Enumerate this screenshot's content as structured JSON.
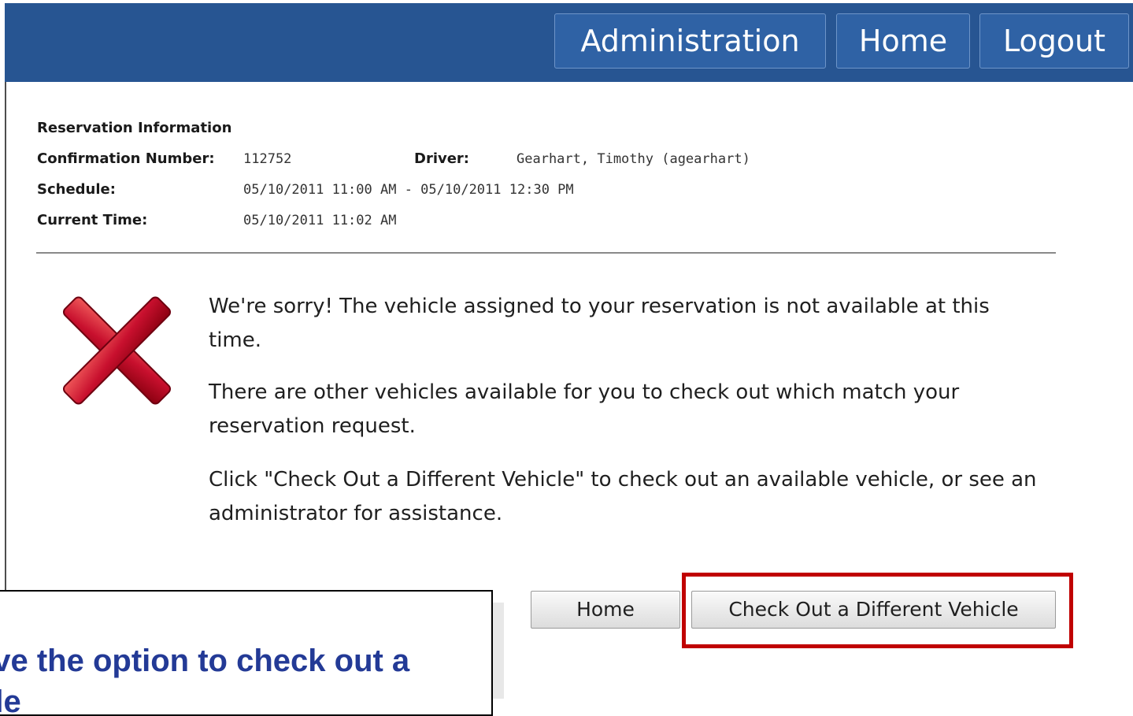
{
  "nav": {
    "administration": "Administration",
    "home": "Home",
    "logout": "Logout"
  },
  "reservation": {
    "heading": "Reservation Information",
    "confirmation_label": "Confirmation Number:",
    "confirmation_value": "112752",
    "driver_label": "Driver:",
    "driver_value": "Gearhart, Timothy (agearhart)",
    "schedule_label": "Schedule:",
    "schedule_value": "05/10/2011 11:00 AM - 05/10/2011 12:30 PM",
    "current_time_label": "Current Time:",
    "current_time_value": "05/10/2011 11:02 AM"
  },
  "message": {
    "line1": "We're sorry! The vehicle assigned to your reservation is not available at this time.",
    "line2": "There are other vehicles available for you to check out which match your reservation request.",
    "line3": "Click \"Check Out a Different Vehicle\" to check out an available vehicle, or see an administrator for assistance."
  },
  "actions": {
    "home": "Home",
    "check_out_different": "Check Out a Different Vehicle"
  },
  "callout": {
    "text": "Drivers will have the option to check out a different vehicle"
  },
  "colors": {
    "header": "#275592",
    "highlight": "#c00000",
    "callout_text": "#233a96",
    "error_icon": "#c8102e"
  },
  "icons": {
    "error": "red-x-icon"
  }
}
